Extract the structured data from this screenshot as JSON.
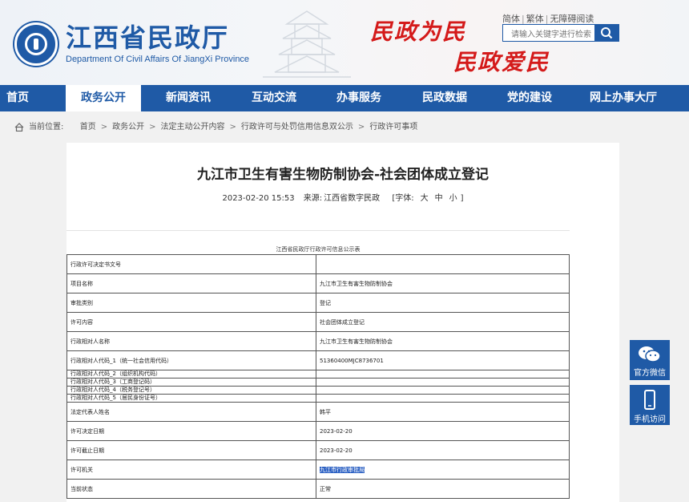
{
  "header": {
    "title": "江西省民政厅",
    "subtitle": "Department Of Civil Affairs Of JiangXi Province",
    "slogan_1": "民政为民",
    "slogan_2": "民政爱民",
    "lang_links": [
      "简体",
      "繁体",
      "无障碍阅读"
    ],
    "search_placeholder": "请输入关键字进行检索"
  },
  "nav": {
    "items": [
      "首页",
      "政务公开",
      "新闻资讯",
      "互动交流",
      "办事服务",
      "民政数据",
      "党的建设",
      "网上办事大厅"
    ],
    "active_index": 1
  },
  "breadcrumb": {
    "prefix": "当前位置:",
    "items": [
      "首页",
      "政务公开",
      "法定主动公开内容",
      "行政许可与处罚信用信息双公示",
      "行政许可事项"
    ]
  },
  "article": {
    "title": "九江市卫生有害生物防制协会-社会团体成立登记",
    "date": "2023-02-20  15:53",
    "source_label": "来源:",
    "source": "江西省数字民政",
    "font_label": "[字体:",
    "font_sizes": [
      "大",
      "中",
      "小"
    ],
    "font_close": "]"
  },
  "table": {
    "caption": "江西省民政厅行政许可信息公示表",
    "rows": [
      {
        "label": "行政许可决定书文号",
        "value": "",
        "size": "tall"
      },
      {
        "label": "项目名称",
        "value": "九江市卫生有害生物防制协会",
        "size": "tall"
      },
      {
        "label": "审批类别",
        "value": "登记",
        "size": "tall"
      },
      {
        "label": "许可内容",
        "value": "社会团体成立登记",
        "size": "tall"
      },
      {
        "label": "行政相对人名称",
        "value": "九江市卫生有害生物防制协会",
        "size": "tall"
      },
      {
        "label": "行政相对人代码_1（统一社会信用代码）",
        "value": "51360400MJC8736701",
        "size": "tall"
      },
      {
        "label": "行政相对人代码_2（组织机构代码）",
        "value": "",
        "size": "small"
      },
      {
        "label": "行政相对人代码_3（工商登记码）",
        "value": "",
        "size": "small"
      },
      {
        "label": "行政相对人代码_4（税务登记号）",
        "value": "",
        "size": "small"
      },
      {
        "label": "行政相对人代码_5（居民身份证号）",
        "value": "",
        "size": "small"
      },
      {
        "label": "法定代表人姓名",
        "value": "韩平",
        "size": "tall"
      },
      {
        "label": "许可决定日期",
        "value": "2023-02-20",
        "size": "tall"
      },
      {
        "label": "许可截止日期",
        "value": "2023-02-20",
        "size": "tall"
      },
      {
        "label": "许可机关",
        "value": "九江市行政审批局",
        "size": "tall",
        "highlight": true
      },
      {
        "label": "当前状态",
        "value": "正常",
        "size": "tall"
      }
    ]
  },
  "side": {
    "wechat_label": "官方微信",
    "mobile_label": "手机访问"
  },
  "colors": {
    "brand_blue": "#1f5aa6",
    "slogan_red": "#d41a1a"
  }
}
